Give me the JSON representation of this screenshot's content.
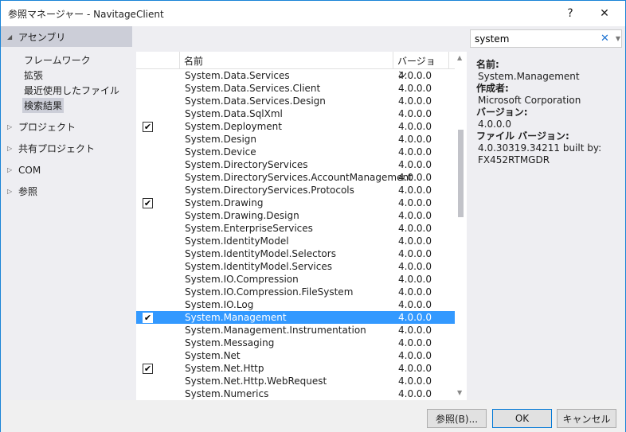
{
  "window": {
    "title": "参照マネージャー - NavitageClient",
    "help": "?",
    "close": "✕"
  },
  "sidebar": {
    "assembly": "アセンブリ",
    "sub": [
      "フレームワーク",
      "拡張",
      "最近使用したファイル",
      "検索結果"
    ],
    "sections": [
      "プロジェクト",
      "共有プロジェクト",
      "COM",
      "参照"
    ]
  },
  "search": {
    "value": "system",
    "clear_icon": "close-icon",
    "dropdown_icon": "chevron-down-icon"
  },
  "list": {
    "headers": [
      "名前",
      "バージョン"
    ],
    "rows": [
      {
        "name": "System.Data.Services",
        "version": "4.0.0.0",
        "checked": false
      },
      {
        "name": "System.Data.Services.Client",
        "version": "4.0.0.0",
        "checked": false
      },
      {
        "name": "System.Data.Services.Design",
        "version": "4.0.0.0",
        "checked": false
      },
      {
        "name": "System.Data.SqlXml",
        "version": "4.0.0.0",
        "checked": false
      },
      {
        "name": "System.Deployment",
        "version": "4.0.0.0",
        "checked": true
      },
      {
        "name": "System.Design",
        "version": "4.0.0.0",
        "checked": false
      },
      {
        "name": "System.Device",
        "version": "4.0.0.0",
        "checked": false
      },
      {
        "name": "System.DirectoryServices",
        "version": "4.0.0.0",
        "checked": false
      },
      {
        "name": "System.DirectoryServices.AccountManagement",
        "version": "4.0.0.0",
        "checked": false
      },
      {
        "name": "System.DirectoryServices.Protocols",
        "version": "4.0.0.0",
        "checked": false
      },
      {
        "name": "System.Drawing",
        "version": "4.0.0.0",
        "checked": true
      },
      {
        "name": "System.Drawing.Design",
        "version": "4.0.0.0",
        "checked": false
      },
      {
        "name": "System.EnterpriseServices",
        "version": "4.0.0.0",
        "checked": false
      },
      {
        "name": "System.IdentityModel",
        "version": "4.0.0.0",
        "checked": false
      },
      {
        "name": "System.IdentityModel.Selectors",
        "version": "4.0.0.0",
        "checked": false
      },
      {
        "name": "System.IdentityModel.Services",
        "version": "4.0.0.0",
        "checked": false
      },
      {
        "name": "System.IO.Compression",
        "version": "4.0.0.0",
        "checked": false
      },
      {
        "name": "System.IO.Compression.FileSystem",
        "version": "4.0.0.0",
        "checked": false
      },
      {
        "name": "System.IO.Log",
        "version": "4.0.0.0",
        "checked": false
      },
      {
        "name": "System.Management",
        "version": "4.0.0.0",
        "checked": true,
        "selected": true
      },
      {
        "name": "System.Management.Instrumentation",
        "version": "4.0.0.0",
        "checked": false
      },
      {
        "name": "System.Messaging",
        "version": "4.0.0.0",
        "checked": false
      },
      {
        "name": "System.Net",
        "version": "4.0.0.0",
        "checked": false
      },
      {
        "name": "System.Net.Http",
        "version": "4.0.0.0",
        "checked": true
      },
      {
        "name": "System.Net.Http.WebRequest",
        "version": "4.0.0.0",
        "checked": false
      },
      {
        "name": "System.Numerics",
        "version": "4.0.0.0",
        "checked": false
      }
    ]
  },
  "details": {
    "name_label": "名前:",
    "name": "System.Management",
    "author_label": "作成者:",
    "author": "Microsoft Corporation",
    "version_label": "バージョン:",
    "version": "4.0.0.0",
    "file_version_label": "ファイル バージョン:",
    "file_version_1": "4.0.30319.34211 built by:",
    "file_version_2": "FX452RTMGDR"
  },
  "buttons": {
    "browse": "参照(B)...",
    "ok": "OK",
    "cancel": "キャンセル"
  },
  "colors": {
    "selection": "#3399ff",
    "accent": "#1883d7"
  }
}
